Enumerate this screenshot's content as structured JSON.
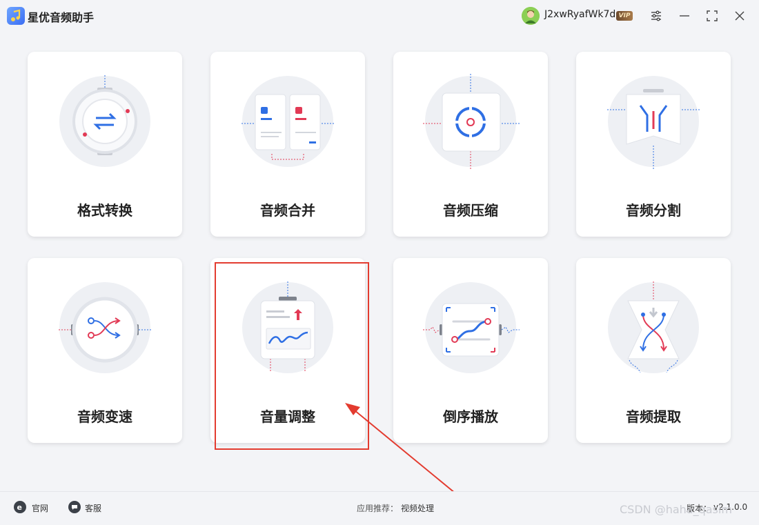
{
  "app": {
    "title": "星优音频助手"
  },
  "user": {
    "name": "J2xwRyafWk7d",
    "badge": "VIP"
  },
  "window_controls": [
    "settings-icon",
    "minimize-icon",
    "maximize-icon",
    "close-icon"
  ],
  "features": [
    {
      "label": "格式转换",
      "icon": "format-convert-icon"
    },
    {
      "label": "音频合并",
      "icon": "audio-merge-icon"
    },
    {
      "label": "音频压缩",
      "icon": "audio-compress-icon"
    },
    {
      "label": "音频分割",
      "icon": "audio-split-icon"
    },
    {
      "label": "音频变速",
      "icon": "audio-speed-icon"
    },
    {
      "label": "音量调整",
      "icon": "volume-adjust-icon"
    },
    {
      "label": "倒序播放",
      "icon": "reverse-play-icon"
    },
    {
      "label": "音频提取",
      "icon": "audio-extract-icon"
    }
  ],
  "footer": {
    "website": "官网",
    "support": "客服",
    "recommend_label": "应用推荐：",
    "recommend_link": "视频处理",
    "version_label": "版本：",
    "version": "v2.1.0.0"
  },
  "watermark": "CSDN @haha_qasim",
  "colors": {
    "accent_blue": "#2f6fe4",
    "accent_red": "#e23a55",
    "highlight": "#e33b2f"
  }
}
